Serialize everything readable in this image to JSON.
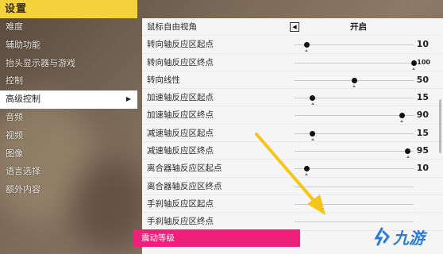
{
  "header": {
    "title": "设置"
  },
  "nav": {
    "items": [
      {
        "label": "难度"
      },
      {
        "label": "辅助功能"
      },
      {
        "label": "抬头显示器与游戏"
      },
      {
        "label": "控制"
      },
      {
        "label": "高级控制",
        "active": true
      },
      {
        "label": "音频"
      },
      {
        "label": "视频"
      },
      {
        "label": "图像"
      },
      {
        "label": "语言选择"
      },
      {
        "label": "额外内容"
      }
    ]
  },
  "settings": {
    "free_camera": {
      "label": "鼠标自由视角",
      "value": "开启"
    },
    "rows": [
      {
        "label": "转向轴反应区起点",
        "value": "10",
        "level": 10
      },
      {
        "label": "转向轴反应区终点",
        "value": "100",
        "level": 100
      },
      {
        "label": "转向线性",
        "value": "50",
        "level": 50
      },
      {
        "label": "加速轴反应区起点",
        "value": "15",
        "level": 15
      },
      {
        "label": "加速轴反应区终点",
        "value": "90",
        "level": 90
      },
      {
        "label": "减速轴反应区起点",
        "value": "15",
        "level": 15
      },
      {
        "label": "减速轴反应区终点",
        "value": "95",
        "level": 95
      },
      {
        "label": "离合器轴反应区起点",
        "value": "10",
        "level": 10
      },
      {
        "label": "离合器轴反应区终点",
        "value": "",
        "level": null
      },
      {
        "label": "手刹轴反应区起点",
        "value": "",
        "level": null
      },
      {
        "label": "手刹轴反应区终点",
        "value": "",
        "level": null
      }
    ],
    "highlighted": {
      "label": "震动等级"
    }
  },
  "watermark": {
    "text": "九游"
  },
  "colors": {
    "header_bg": "#f3d23b",
    "highlight": "#f0207a",
    "pointer": "#f5c518",
    "watermark": "#2b7bd6"
  }
}
